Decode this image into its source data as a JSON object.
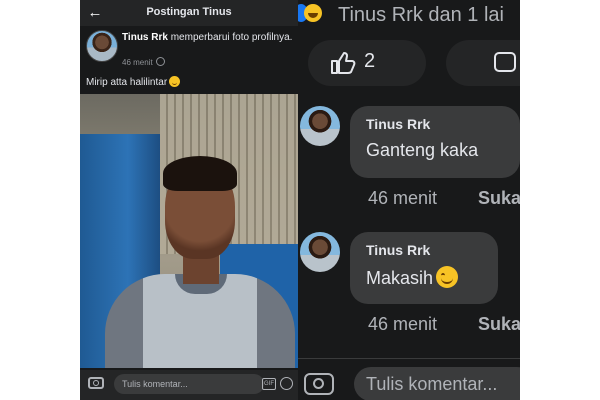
{
  "left": {
    "header_title": "Postingan Tinus",
    "author_name": "Tinus Rrk",
    "author_action": "memperbarui foto profilnya.",
    "timestamp": "46 menit",
    "caption": "Mirip atta halilintar",
    "comment_placeholder": "Tulis komentar...",
    "gif_label": "GIF"
  },
  "right": {
    "header_text": "Tinus Rrk dan 1 lai",
    "like_count": "2",
    "comments": [
      {
        "name": "Tinus Rrk",
        "text": "Ganteng kaka",
        "time": "46 menit",
        "like_label": "Suka"
      },
      {
        "name": "Tinus Rrk",
        "text": "Makasih",
        "time": "46 menit",
        "like_label": "Suka"
      }
    ],
    "comment_placeholder": "Tulis komentar..."
  },
  "colors": {
    "background": "#18191a",
    "bubble": "#3a3b3c",
    "text_primary": "#e4e6eb",
    "text_secondary": "#b0b3b8",
    "accent": "#1877f2"
  }
}
